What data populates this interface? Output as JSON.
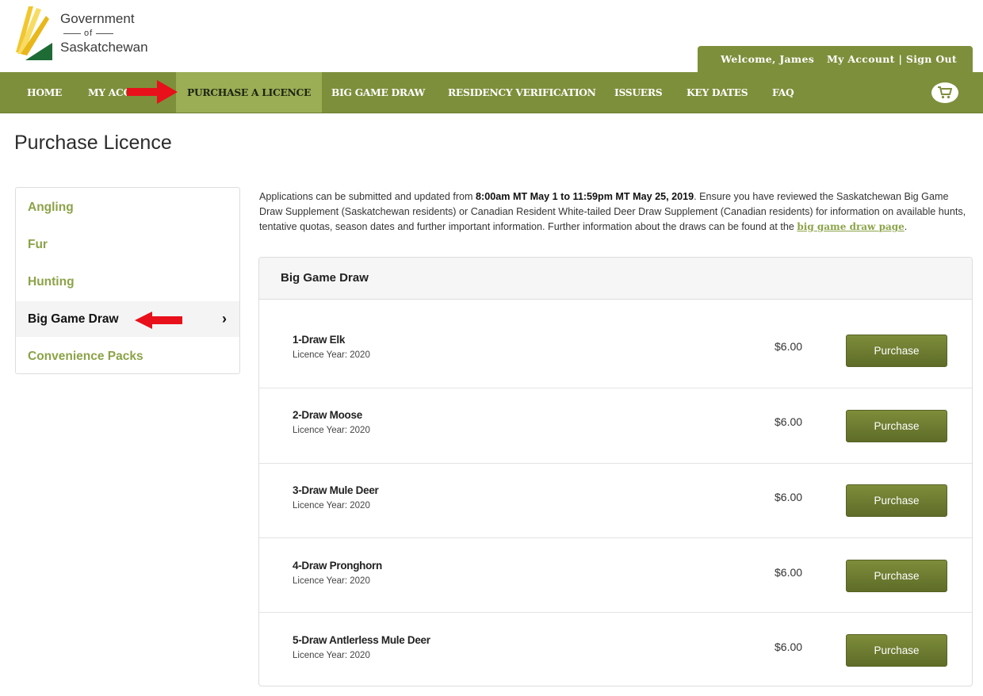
{
  "logo": {
    "line1": "Government",
    "line2": "of",
    "line3": "Saskatchewan"
  },
  "account": {
    "welcome": "Welcome, James",
    "my_account": "My Account",
    "separator": "|",
    "sign_out": "Sign Out"
  },
  "nav": {
    "items": [
      {
        "label": "HOME"
      },
      {
        "label": "MY ACCOUNT"
      },
      {
        "label": "PURCHASE A LICENCE"
      },
      {
        "label": "BIG GAME DRAW"
      },
      {
        "label": "RESIDENCY VERIFICATION"
      },
      {
        "label": "ISSUERS"
      },
      {
        "label": "KEY DATES"
      },
      {
        "label": "FAQ"
      }
    ],
    "cart_icon": "shopping-cart-icon"
  },
  "page": {
    "title": "Purchase Licence"
  },
  "sidebar": {
    "items": [
      {
        "label": "Angling"
      },
      {
        "label": "Fur"
      },
      {
        "label": "Hunting"
      },
      {
        "label": "Big Game Draw",
        "chevron": "›"
      },
      {
        "label": "Convenience Packs"
      }
    ]
  },
  "intro": {
    "t1": "Applications can be submitted and updated from ",
    "b1": "8:00am MT May 1 to 11:59pm MT May 25, 2019",
    "t2": ". Ensure you have reviewed the Saskatchewan Big Game Draw Supplement (Saskatchewan residents) or Canadian Resident White-tailed Deer Draw Supplement (Canadian residents) for information on available hunts, tentative quotas, season dates and further important information. Further information about the draws can be found at the ",
    "link": "big game draw page",
    "t3": "."
  },
  "panel": {
    "title": "Big Game Draw",
    "items": [
      {
        "name": "1-Draw Elk",
        "year": "Licence Year: 2020",
        "price": "$6.00",
        "button": "Purchase"
      },
      {
        "name": "2-Draw Moose",
        "year": "Licence Year: 2020",
        "price": "$6.00",
        "button": "Purchase"
      },
      {
        "name": "3-Draw Mule Deer",
        "year": "Licence Year: 2020",
        "price": "$6.00",
        "button": "Purchase"
      },
      {
        "name": "4-Draw Pronghorn",
        "year": "Licence Year: 2020",
        "price": "$6.00",
        "button": "Purchase"
      },
      {
        "name": "5-Draw Antlerless Mule Deer",
        "year": "Licence Year: 2020",
        "price": "$6.00",
        "button": "Purchase"
      }
    ]
  },
  "colors": {
    "brand_green": "#7d8f3b",
    "nav_active": "#9bad55",
    "link_green": "#8ba348",
    "arrow_red": "#e8101a"
  }
}
